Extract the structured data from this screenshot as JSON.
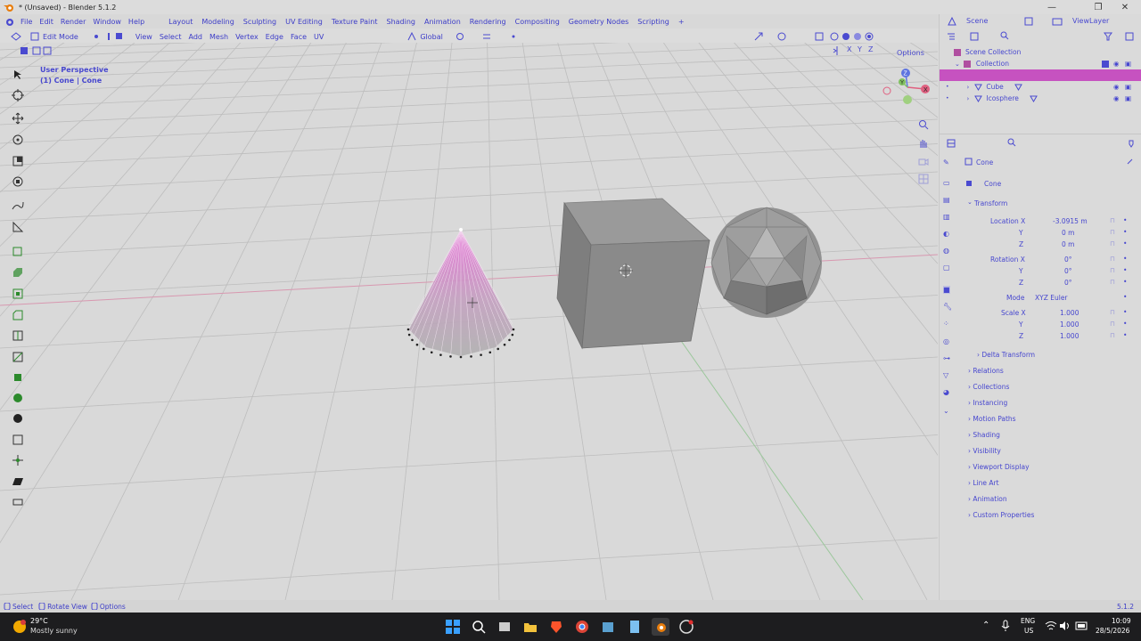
{
  "window": {
    "title": "* (Unsaved) - Blender 5.1.2",
    "controls": [
      "minimize",
      "maximize",
      "close"
    ]
  },
  "menubar": {
    "items": [
      "File",
      "Edit",
      "Render",
      "Window",
      "Help"
    ],
    "workspaces": [
      "Layout",
      "Modeling",
      "Sculpting",
      "UV Editing",
      "Texture Paint",
      "Shading",
      "Animation",
      "Rendering",
      "Compositing",
      "Geometry Nodes",
      "Scripting"
    ],
    "add_tab": "+",
    "scene_label": "Scene",
    "viewlayer_label": "ViewLayer"
  },
  "viewport_header": {
    "mode": "Edit Mode",
    "menus": [
      "View",
      "Select",
      "Add",
      "Mesh",
      "Vertex",
      "Edge",
      "Face",
      "UV"
    ],
    "orientation": "Global",
    "options": "Options",
    "axes": [
      "X",
      "Y",
      "Z"
    ]
  },
  "viewport": {
    "overlay_line1": "User Perspective",
    "overlay_line2": "(1) Cone | Cone",
    "gizmo": {
      "x": "X",
      "y": "Y",
      "z": "Z"
    }
  },
  "outliner": {
    "rows": [
      {
        "label": "Scene Collection"
      },
      {
        "label": "Collection"
      },
      {
        "label": ""
      },
      {
        "label": "Cube"
      },
      {
        "label": "Icosphere"
      }
    ]
  },
  "properties": {
    "object_name": "Cone",
    "data_name": "Cone",
    "transform_title": "Transform",
    "location": {
      "label": "Location X",
      "x": "-3.0915 m",
      "y": "0 m",
      "z": "0 m"
    },
    "rotation": {
      "label": "Rotation X",
      "x": "0°",
      "y": "0°",
      "z": "0°"
    },
    "mode_label": "Mode",
    "mode_value": "XYZ Euler",
    "scale": {
      "label": "Scale X",
      "x": "1.000",
      "y": "1.000",
      "z": "1.000"
    },
    "axis_y": "Y",
    "axis_z": "Z",
    "sections": [
      "Delta Transform",
      "Relations",
      "Collections",
      "Instancing",
      "Motion Paths",
      "Shading",
      "Visibility",
      "Viewport Display",
      "Line Art",
      "Animation",
      "Custom Properties"
    ]
  },
  "statusbar": {
    "select": "Select",
    "rotate": "Rotate View",
    "options": "Options",
    "version": "5.1.2"
  },
  "taskbar": {
    "weather_temp": "29°C",
    "weather_desc": "Mostly sunny",
    "language": "ENG",
    "region": "US",
    "time": "10:09",
    "date": "28/5/2026"
  },
  "colors": {
    "accent": "#4a4ad0",
    "selection": "#c652c0",
    "viewport_bg": "#d9d9d9",
    "taskbar_bg": "#1d1d1f"
  }
}
